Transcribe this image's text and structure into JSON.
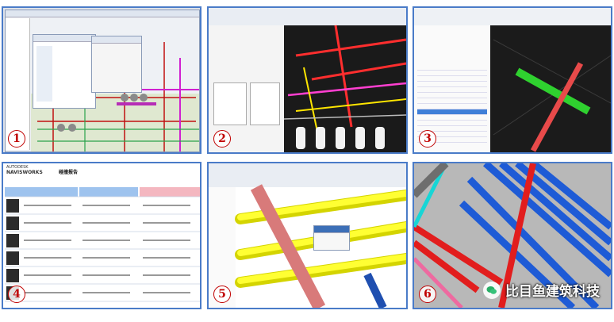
{
  "panels": [
    {
      "num": "1"
    },
    {
      "num": "2"
    },
    {
      "num": "3"
    },
    {
      "num": "4"
    },
    {
      "num": "5"
    },
    {
      "num": "6"
    }
  ],
  "report": {
    "brand": "AUTODESK",
    "product": "NAVISWORKS",
    "title": "碰撞报告"
  },
  "watermark": {
    "text": "比目鱼建筑科技"
  },
  "colors": {
    "frame": "#4a7bc8",
    "number": "#c00000"
  }
}
